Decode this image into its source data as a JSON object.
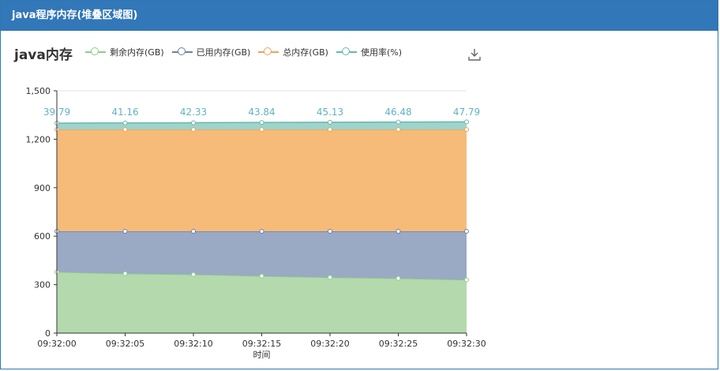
{
  "panel": {
    "title": "java程序内存(堆叠区域图)"
  },
  "chart_data": {
    "type": "area",
    "stacked": true,
    "title": "java内存",
    "xlabel": "时间",
    "ylabel": "",
    "x": [
      "09:32:00",
      "09:32:05",
      "09:32:10",
      "09:32:15",
      "09:32:20",
      "09:32:25",
      "09:32:30"
    ],
    "ylim": [
      0,
      1500
    ],
    "yticks": [
      0,
      300,
      600,
      900,
      1200,
      1500
    ],
    "ytick_labels": [
      "0",
      "300",
      "600",
      "900",
      "1,200",
      "1,500"
    ],
    "grid": true,
    "legend_position": "top",
    "series": [
      {
        "name": "剩余内存(GB)",
        "color": "#91cc75",
        "values": [
          378,
          368,
          363,
          353,
          345,
          339,
          330
        ]
      },
      {
        "name": "已用内存(GB)",
        "color": "#5470c6",
        "values": [
          252,
          262,
          267,
          277,
          285,
          291,
          300
        ]
      },
      {
        "name": "总内存(GB)",
        "color": "#fac858",
        "values": [
          630,
          630,
          630,
          630,
          630,
          630,
          630
        ]
      },
      {
        "name": "使用率(%)",
        "color": "#73c0de",
        "values": [
          39.79,
          41.16,
          42.33,
          43.84,
          45.13,
          46.48,
          47.79
        ]
      }
    ],
    "data_labels": [
      "39.79",
      "41.16",
      "42.33",
      "43.84",
      "45.13",
      "46.48",
      "47.79"
    ]
  },
  "icons": {
    "download": "download-icon"
  }
}
